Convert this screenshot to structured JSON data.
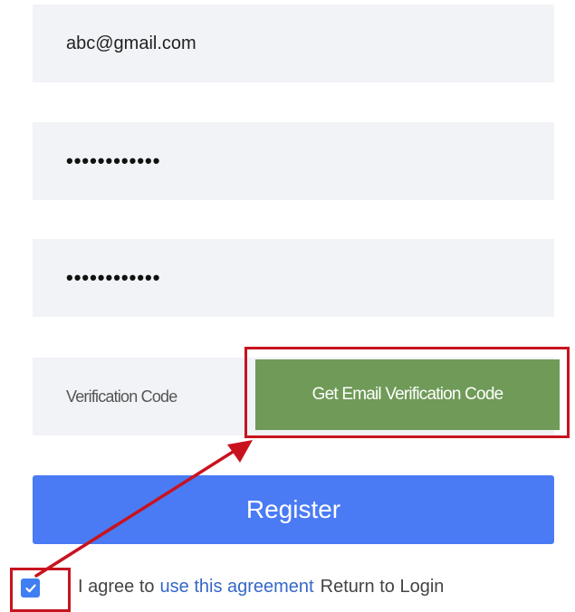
{
  "form": {
    "email_value": "abc@gmail.com",
    "password_value": "••••••••••••",
    "confirm_password_value": "••••••••••••",
    "verification_placeholder": "Verification Code",
    "get_code_label": "Get Email Verification Code",
    "register_label": "Register",
    "agreement": {
      "checked": true,
      "prefix": "I agree to",
      "link_label": "use this agreement",
      "return_label": "Return to Login"
    }
  },
  "annotations": {
    "highlight_color": "#c8131f"
  },
  "colors": {
    "field_bg": "#f1f3f6",
    "get_code_bg": "#6f9a57",
    "register_bg": "#4a7bf5",
    "checkbox_bg": "#3f7ff3",
    "link": "#3568c6"
  }
}
